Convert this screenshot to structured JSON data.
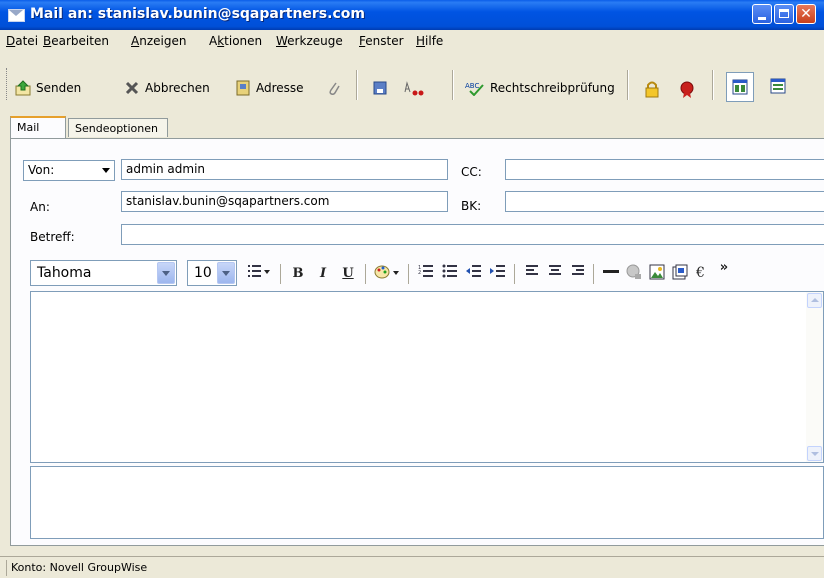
{
  "window": {
    "title": "Mail an: stanislav.bunin@sqapartners.com",
    "accent": "#0054e3"
  },
  "menu": [
    "Datei",
    "Bearbeiten",
    "Anzeigen",
    "Aktionen",
    "Werkzeuge",
    "Fenster",
    "Hilfe"
  ],
  "menu_accel": [
    "D",
    "B",
    "A",
    "k",
    "W",
    "F",
    "H"
  ],
  "toolbar": {
    "send_label": "Senden",
    "cancel_label": "Abbrechen",
    "address_label": "Adresse",
    "spellcheck_label": "Rechtschreibprüfung",
    "icons": [
      "send-icon",
      "cancel-icon",
      "address-book-icon",
      "paperclip-icon",
      "save-icon",
      "signature-icon",
      "spellcheck-icon",
      "lock-icon",
      "seal-icon",
      "view-toggle-icon",
      "view-toggle-2-icon"
    ]
  },
  "tabs": [
    {
      "label": "Mail",
      "active": true
    },
    {
      "label": "Sendeoptionen",
      "active": false
    }
  ],
  "form": {
    "from_label": "Von:",
    "from_value": "admin admin",
    "to_label": "An:",
    "to_value": "stanislav.bunin@sqapartners.com",
    "subject_label": "Betreff:",
    "subject_value": "",
    "cc_label": "CC:",
    "cc_value": "",
    "bcc_label": "BK:",
    "bcc_value": ""
  },
  "format": {
    "font": "Tahoma",
    "size": "10",
    "bold": "B",
    "italic": "I",
    "underline": "U",
    "more": "»"
  },
  "status": {
    "account": "Konto: Novell GroupWise"
  }
}
